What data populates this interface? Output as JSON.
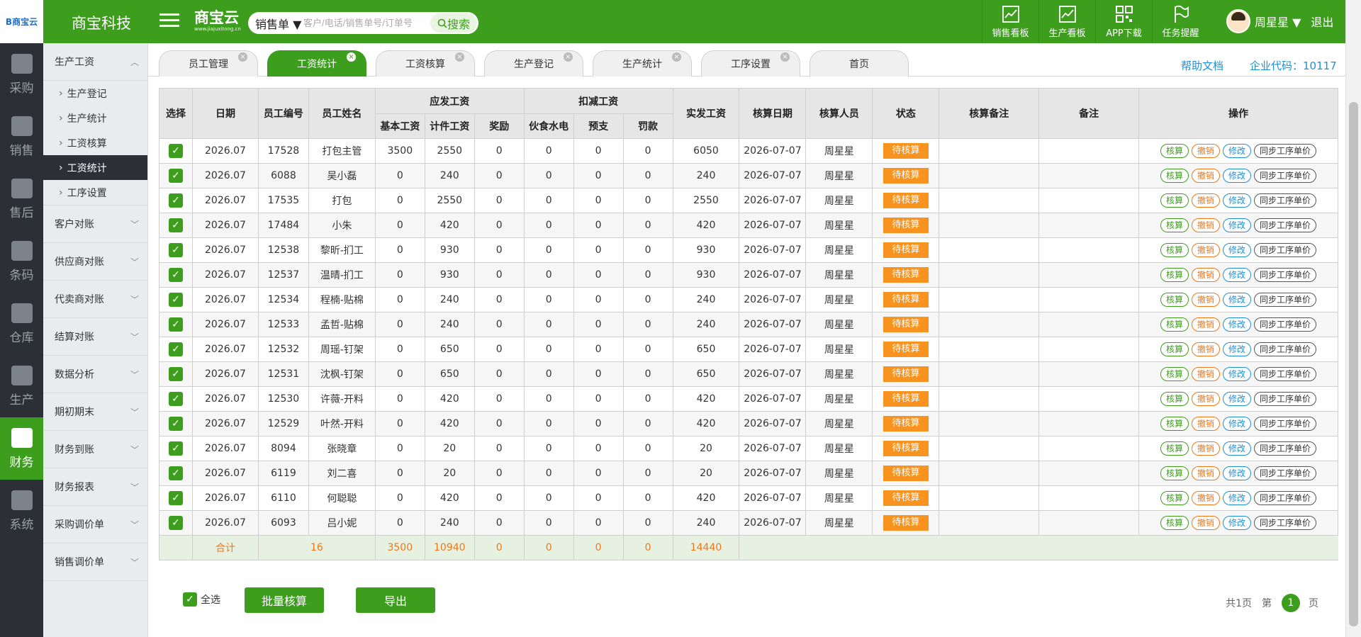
{
  "header": {
    "logo_text": "B商宝云",
    "company": "商宝科技",
    "brand_name": "商宝云",
    "brand_url": "www.jiajuxitong.cn",
    "search_type": "销售单 ▼",
    "search_placeholder": "客户/电话/销售单号/订单号",
    "search_button": "搜索",
    "nav": [
      {
        "label": "销售看板"
      },
      {
        "label": "生产看板"
      },
      {
        "label": "APP下载"
      },
      {
        "label": "任务提醒"
      }
    ],
    "user_name": "周星星 ▼",
    "logout": "退出"
  },
  "rail": [
    {
      "label": "采购"
    },
    {
      "label": "销售"
    },
    {
      "label": "售后"
    },
    {
      "label": "条码"
    },
    {
      "label": "仓库"
    },
    {
      "label": "生产"
    },
    {
      "label": "财务"
    },
    {
      "label": "系统"
    }
  ],
  "submenu": {
    "expanded_group": "生产工资",
    "children": [
      "生产登记",
      "生产统计",
      "工资核算",
      "工资统计",
      "工序设置"
    ],
    "groups": [
      "客户对账",
      "供应商对账",
      "代卖商对账",
      "结算对账",
      "数据分析",
      "期初期末",
      "财务到账",
      "财务报表",
      "采购调价单",
      "销售调价单"
    ]
  },
  "tabs": [
    {
      "label": "员工管理",
      "close": "×"
    },
    {
      "label": "工资统计",
      "close": "×"
    },
    {
      "label": "工资核算",
      "close": "×"
    },
    {
      "label": "生产登记",
      "close": "×"
    },
    {
      "label": "生产统计",
      "close": "×"
    },
    {
      "label": "工序设置",
      "close": "×"
    },
    {
      "label": "首页",
      "close": ""
    }
  ],
  "help_link": "帮助文档",
  "corp_code": "企业代码：10117",
  "table": {
    "headers": {
      "select": "选择",
      "date": "日期",
      "emp_no": "员工编号",
      "emp_name": "员工姓名",
      "payable": "应发工资",
      "base": "基本工资",
      "piece": "计件工资",
      "bonus": "奖励",
      "deduct": "扣减工资",
      "meals": "伙食水电",
      "advance": "预支",
      "fine": "罚款",
      "actual": "实发工资",
      "check_date": "核算日期",
      "checker": "核算人员",
      "status": "状态",
      "check_note": "核算备注",
      "note": "备注",
      "ops": "操作"
    },
    "op_labels": {
      "calc": "核算",
      "undo": "撤销",
      "edit": "修改",
      "sync": "同步工序单价"
    },
    "rows": [
      {
        "date": "2026.07",
        "no": "17528",
        "name": "打包主管",
        "base": "3500",
        "piece": "2550",
        "bonus": "0",
        "meals": "0",
        "advance": "0",
        "fine": "0",
        "actual": "6050",
        "cdate": "2026-07-07",
        "checker": "周星星",
        "status": "待核算"
      },
      {
        "date": "2026.07",
        "no": "6088",
        "name": "吴小磊",
        "base": "0",
        "piece": "240",
        "bonus": "0",
        "meals": "0",
        "advance": "0",
        "fine": "0",
        "actual": "240",
        "cdate": "2026-07-07",
        "checker": "周星星",
        "status": "待核算"
      },
      {
        "date": "2026.07",
        "no": "17535",
        "name": "打包",
        "base": "0",
        "piece": "2550",
        "bonus": "0",
        "meals": "0",
        "advance": "0",
        "fine": "0",
        "actual": "2550",
        "cdate": "2026-07-07",
        "checker": "周星星",
        "status": "待核算"
      },
      {
        "date": "2026.07",
        "no": "17484",
        "name": "小朱",
        "base": "0",
        "piece": "420",
        "bonus": "0",
        "meals": "0",
        "advance": "0",
        "fine": "0",
        "actual": "420",
        "cdate": "2026-07-07",
        "checker": "周星星",
        "status": "待核算"
      },
      {
        "date": "2026.07",
        "no": "12538",
        "name": "黎昕-扪工",
        "base": "0",
        "piece": "930",
        "bonus": "0",
        "meals": "0",
        "advance": "0",
        "fine": "0",
        "actual": "930",
        "cdate": "2026-07-07",
        "checker": "周星星",
        "status": "待核算"
      },
      {
        "date": "2026.07",
        "no": "12537",
        "name": "温晴-扪工",
        "base": "0",
        "piece": "930",
        "bonus": "0",
        "meals": "0",
        "advance": "0",
        "fine": "0",
        "actual": "930",
        "cdate": "2026-07-07",
        "checker": "周星星",
        "status": "待核算"
      },
      {
        "date": "2026.07",
        "no": "12534",
        "name": "程楠-贴棉",
        "base": "0",
        "piece": "240",
        "bonus": "0",
        "meals": "0",
        "advance": "0",
        "fine": "0",
        "actual": "240",
        "cdate": "2026-07-07",
        "checker": "周星星",
        "status": "待核算"
      },
      {
        "date": "2026.07",
        "no": "12533",
        "name": "孟哲-贴棉",
        "base": "0",
        "piece": "240",
        "bonus": "0",
        "meals": "0",
        "advance": "0",
        "fine": "0",
        "actual": "240",
        "cdate": "2026-07-07",
        "checker": "周星星",
        "status": "待核算"
      },
      {
        "date": "2026.07",
        "no": "12532",
        "name": "周瑶-钉架",
        "base": "0",
        "piece": "650",
        "bonus": "0",
        "meals": "0",
        "advance": "0",
        "fine": "0",
        "actual": "650",
        "cdate": "2026-07-07",
        "checker": "周星星",
        "status": "待核算"
      },
      {
        "date": "2026.07",
        "no": "12531",
        "name": "沈枫-钉架",
        "base": "0",
        "piece": "650",
        "bonus": "0",
        "meals": "0",
        "advance": "0",
        "fine": "0",
        "actual": "650",
        "cdate": "2026-07-07",
        "checker": "周星星",
        "status": "待核算"
      },
      {
        "date": "2026.07",
        "no": "12530",
        "name": "许薇-开料",
        "base": "0",
        "piece": "420",
        "bonus": "0",
        "meals": "0",
        "advance": "0",
        "fine": "0",
        "actual": "420",
        "cdate": "2026-07-07",
        "checker": "周星星",
        "status": "待核算"
      },
      {
        "date": "2026.07",
        "no": "12529",
        "name": "叶然-开料",
        "base": "0",
        "piece": "420",
        "bonus": "0",
        "meals": "0",
        "advance": "0",
        "fine": "0",
        "actual": "420",
        "cdate": "2026-07-07",
        "checker": "周星星",
        "status": "待核算"
      },
      {
        "date": "2026.07",
        "no": "8094",
        "name": "张晓章",
        "base": "0",
        "piece": "20",
        "bonus": "0",
        "meals": "0",
        "advance": "0",
        "fine": "0",
        "actual": "20",
        "cdate": "2026-07-07",
        "checker": "周星星",
        "status": "待核算"
      },
      {
        "date": "2026.07",
        "no": "6119",
        "name": "刘二喜",
        "base": "0",
        "piece": "20",
        "bonus": "0",
        "meals": "0",
        "advance": "0",
        "fine": "0",
        "actual": "20",
        "cdate": "2026-07-07",
        "checker": "周星星",
        "status": "待核算"
      },
      {
        "date": "2026.07",
        "no": "6110",
        "name": "何聪聪",
        "base": "0",
        "piece": "420",
        "bonus": "0",
        "meals": "0",
        "advance": "0",
        "fine": "0",
        "actual": "420",
        "cdate": "2026-07-07",
        "checker": "周星星",
        "status": "待核算"
      },
      {
        "date": "2026.07",
        "no": "6093",
        "name": "吕小妮",
        "base": "0",
        "piece": "240",
        "bonus": "0",
        "meals": "0",
        "advance": "0",
        "fine": "0",
        "actual": "240",
        "cdate": "2026-07-07",
        "checker": "周星星",
        "status": "待核算"
      }
    ],
    "totals": {
      "label": "合计",
      "count": "16",
      "base": "3500",
      "piece": "10940",
      "bonus": "0",
      "meals": "0",
      "advance": "0",
      "fine": "0",
      "actual": "14440"
    }
  },
  "bottom": {
    "select_all": "全选",
    "batch_calc": "批量核算",
    "export": "导出",
    "pager_total": "共1页",
    "pager_prefix": "第",
    "pager_current": "1",
    "pager_suffix": "页"
  },
  "colors": {
    "brand_green": "#3d9e1e",
    "status_orange": "#f7931e",
    "link_blue": "#1e90d6",
    "rail_dark": "#2c2f36"
  }
}
